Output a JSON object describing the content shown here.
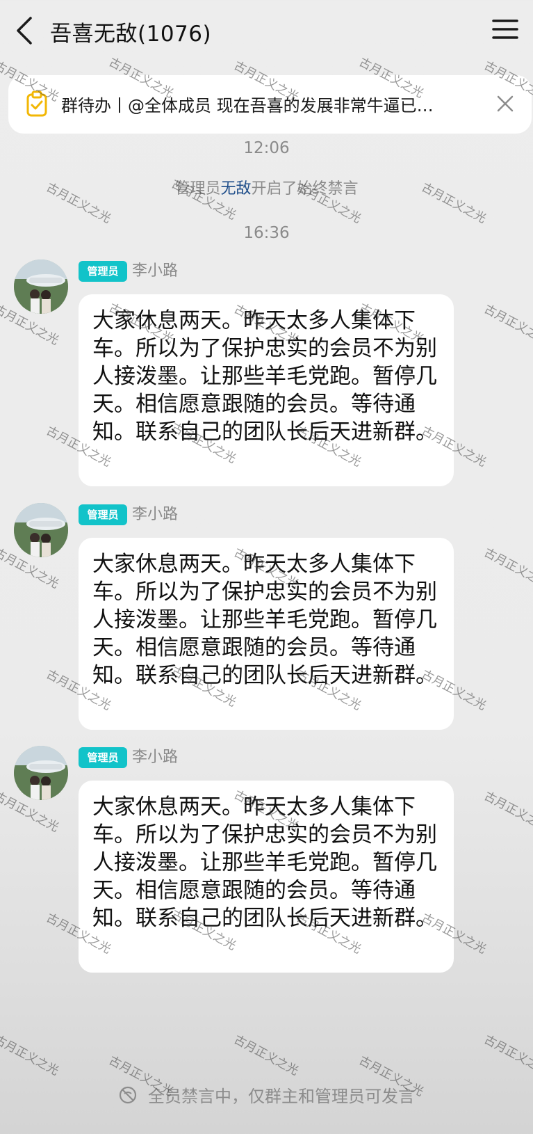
{
  "header": {
    "back_icon": "chevron-left-icon",
    "title": "吾喜无敌(1076)",
    "menu_icon": "hamburger-menu-icon"
  },
  "todo_banner": {
    "icon": "clipboard-check-icon",
    "text": "群待办丨@全体成员 现在吾喜的发展非常牛逼已…",
    "close_icon": "close-icon"
  },
  "timeline": {
    "time1": "12:06",
    "admin_prefix": "管理员",
    "admin_name": "无敌",
    "admin_suffix": "开启了始终禁言",
    "time2": "16:36"
  },
  "messages": [
    {
      "role": "管理员",
      "sender": "李小路",
      "text": "大家休息两天。昨天太多人集体下车。所以为了保护忠实的会员不为别人接泼墨。让那些羊毛党跑。暂停几天。相信愿意跟随的会员。等待通知。联系自己的团队长后天进新群。"
    },
    {
      "role": "管理员",
      "sender": "李小路",
      "text": "大家休息两天。昨天太多人集体下车。所以为了保护忠实的会员不为别人接泼墨。让那些羊毛党跑。暂停几天。相信愿意跟随的会员。等待通知。联系自己的团队长后天进新群。"
    },
    {
      "role": "管理员",
      "sender": "李小路",
      "text": "大家休息两天。昨天太多人集体下车。所以为了保护忠实的会员不为别人接泼墨。让那些羊毛党跑。暂停几天。相信愿意跟随的会员。等待通知。联系自己的团队长后天进新群。"
    }
  ],
  "footer": {
    "icon": "mute-icon",
    "text": "全员禁言中，仅群主和管理员可发言"
  },
  "watermark": {
    "text": "古月正义之光"
  },
  "colors": {
    "background": "#ededed",
    "bubble": "#ffffff",
    "badge": "#12c3c9",
    "admin_name": "#1f4e8a",
    "muted_text": "#8a8a8a"
  }
}
